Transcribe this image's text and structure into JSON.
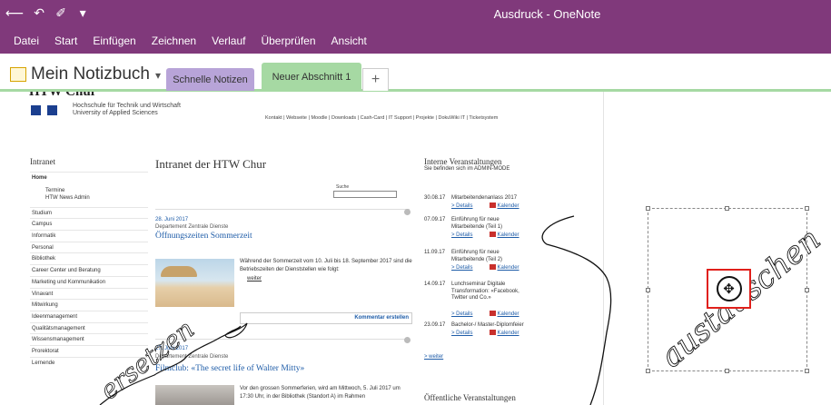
{
  "window": {
    "title": "Ausdruck - OneNote",
    "qat_icons": [
      "back-icon",
      "undo-icon",
      "touch-mode-icon",
      "customize-qat-icon"
    ],
    "qat_glyphs": [
      "⟵",
      "↶",
      "✐",
      "▾"
    ]
  },
  "colors": {
    "titlebar": "#80397b",
    "section_green": "#a6d9a3",
    "section_purple": "#b8a4d8",
    "link_blue": "#1e5ca8",
    "highlight_red": "#e0201b"
  },
  "menu": [
    "Datei",
    "Start",
    "Einfügen",
    "Zeichnen",
    "Verlauf",
    "Überprüfen",
    "Ansicht"
  ],
  "notebook": {
    "name": "Mein Notizbuch",
    "chevron": "▾",
    "tabs": [
      {
        "label": "Schnelle Notizen"
      },
      {
        "label": "Neuer Abschnitt 1"
      }
    ],
    "add_tab": "+"
  },
  "printout": {
    "logo": {
      "name": "HTW Chur",
      "line1": "Hochschule für Technik und Wirtschaft",
      "line2": "University of Applied Sciences"
    },
    "top_links": "Kontakt | Webseite | Moodle | Downloads | Cash-Card | IT Support | Projekte | DokuWiki IT | Ticketsystem",
    "sidebar": {
      "heading": "Intranet",
      "home": "Home",
      "subitems": [
        "Termine",
        "HTW News Admin"
      ],
      "items": [
        "Studium",
        "Campus",
        "Informatik",
        "Personal",
        "Bibliothek",
        "Career Center und Beratung",
        "Marketing und Kommunikation",
        "Vinavant",
        "Mitwirkung",
        "Ideenmanagement",
        "Qualitätsmanagement",
        "Wissensmanagement",
        "Prorektorat",
        "Lernende"
      ]
    },
    "center": {
      "title": "Intranet der HTW Chur",
      "search_label": "Suche",
      "news": [
        {
          "date": "28. Juni 2017",
          "dept": "Departement Zentrale Dienste",
          "headline": "Öffnungszeiten Sommerzeit",
          "body": "Während der Sommerzeit vom 10. Juli bis 18. September 2017 sind die Betriebszeiten der Dienststellen wie folgt:",
          "more": "weiter"
        },
        {
          "date": "27. Juni 2017",
          "dept": "Departement Zentrale Dienste",
          "headline": "Filmclub: «The secret life of Walter Mitty»",
          "body": "Vor den grossen Sommerferien, wird am Mittwoch, 5. Juli 2017 um 17:30 Uhr, in der Bibliothek (Standort A) im Rahmen"
        }
      ],
      "comment_button": "Kommentar erstellen"
    },
    "right": {
      "heading": "Interne Veranstaltungen",
      "sub": "Sie befinden sich im ADMIN-MODE",
      "details_label": "> Details",
      "calendar_label": "Kalender",
      "events": [
        {
          "date": "30.08.17",
          "title": "Mitarbeitendenanlass 2017"
        },
        {
          "date": "07.09.17",
          "title": "Einführung für neue Mitarbeitende (Teil 1)"
        },
        {
          "date": "11.09.17",
          "title": "Einführung für neue Mitarbeitende (Teil 2)"
        },
        {
          "date": "14.09.17",
          "title": "Lunchseminar Digitale Transformation: «Facebook, Twitter und Co.»"
        },
        {
          "date": "23.09.17",
          "title": "Bachelor-/ Master-Diplomfeier"
        }
      ],
      "more": "> weiter",
      "public_heading": "Öffentliche Veranstaltungen"
    }
  },
  "ink": {
    "right_word": "austauschen",
    "left_word": "ersetzen"
  },
  "move_handle_icon": "✥"
}
